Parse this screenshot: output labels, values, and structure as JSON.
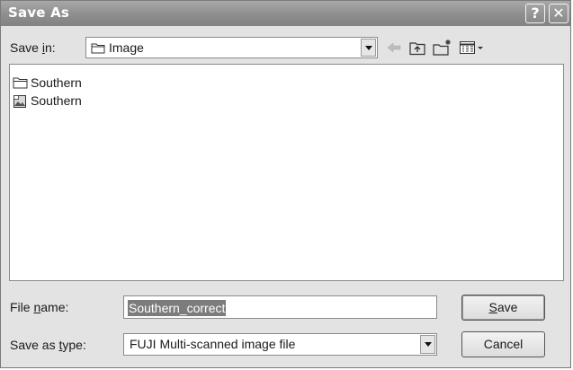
{
  "window": {
    "title": "Save As",
    "help_glyph": "?",
    "close_glyph": "✕"
  },
  "save_in": {
    "label_pre": "Save ",
    "label_key": "i",
    "label_post": "n:",
    "value": "Image"
  },
  "toolbar": {
    "icons": [
      "back-arrow-icon",
      "up-one-level-icon",
      "create-new-folder-icon",
      "view-menu-icon"
    ]
  },
  "files": [
    {
      "name": "Southern",
      "icon": "folder-icon"
    },
    {
      "name": "Southern",
      "icon": "image-file-icon"
    }
  ],
  "file_name": {
    "label_pre": "File ",
    "label_key": "n",
    "label_post": "ame:",
    "value": "Southern_correct"
  },
  "save_as_type": {
    "label_pre": "Save as ",
    "label_key": "t",
    "label_post": "ype:",
    "value": "FUJI Multi-scanned image file"
  },
  "buttons": {
    "save_key": "S",
    "save_rest": "ave",
    "cancel": "Cancel"
  },
  "colors": {
    "titlebar": "#8e8e8e",
    "dialog_bg": "#e3e3e3",
    "selection": "#7c7c7c"
  }
}
